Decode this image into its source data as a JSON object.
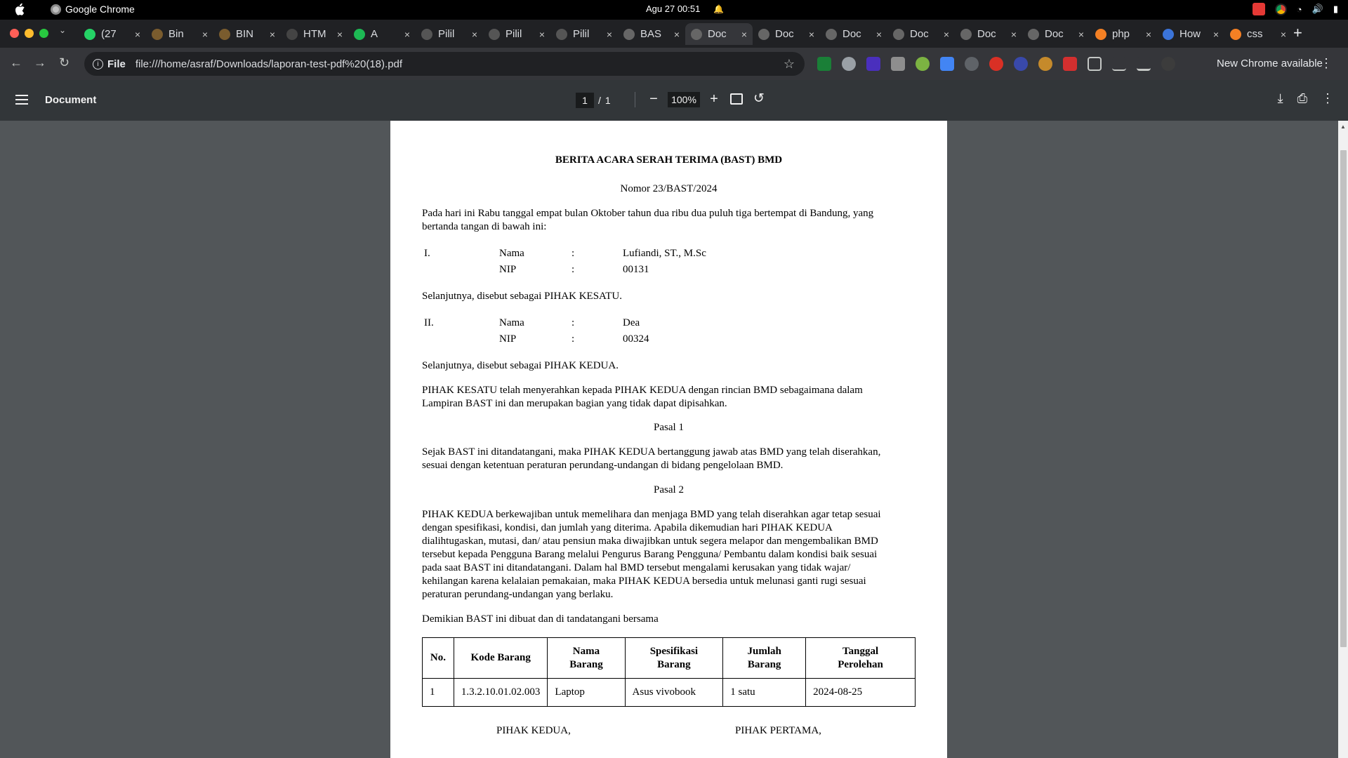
{
  "menubar": {
    "app_name": "Google Chrome",
    "clock": "Agu 27  00:51"
  },
  "tabs": [
    {
      "title": "(27",
      "favicon": "whatsapp-icon",
      "color": "#25d366"
    },
    {
      "title": "Bin",
      "favicon": "binance-icon",
      "color": "#7a5c2e"
    },
    {
      "title": "BIN",
      "favicon": "binance-icon",
      "color": "#7a5c2e"
    },
    {
      "title": "HTM",
      "favicon": "openai-icon",
      "color": "#444"
    },
    {
      "title": "A",
      "favicon": "spotify-icon",
      "color": "#1db954"
    },
    {
      "title": "Pilil",
      "favicon": "link-icon",
      "color": "#555"
    },
    {
      "title": "Pilil",
      "favicon": "link-icon",
      "color": "#555"
    },
    {
      "title": "Pilil",
      "favicon": "link-icon",
      "color": "#555"
    },
    {
      "title": "BAS",
      "favicon": "globe-icon",
      "color": "#666"
    },
    {
      "title": "Doc",
      "favicon": "globe-icon",
      "color": "#666",
      "active": true
    },
    {
      "title": "Doc",
      "favicon": "globe-icon",
      "color": "#666"
    },
    {
      "title": "Doc",
      "favicon": "globe-icon",
      "color": "#666"
    },
    {
      "title": "Doc",
      "favicon": "globe-icon",
      "color": "#666"
    },
    {
      "title": "Doc",
      "favicon": "globe-icon",
      "color": "#666"
    },
    {
      "title": "Doc",
      "favicon": "globe-icon",
      "color": "#666"
    },
    {
      "title": "php",
      "favicon": "stackoverflow-icon",
      "color": "#f48024"
    },
    {
      "title": "How",
      "favicon": "ycombinator-icon",
      "color": "#3b74d9"
    },
    {
      "title": "css",
      "favicon": "stackoverflow-icon",
      "color": "#f48024"
    }
  ],
  "toolbar": {
    "scheme": "File",
    "url": "file:///home/asraf/Downloads/laporan-test-pdf%20(18).pdf",
    "update_label": "New Chrome available"
  },
  "pdf": {
    "title": "Document",
    "page_current": "1",
    "page_sep": "/",
    "page_total": "1",
    "zoom": "100%"
  },
  "doc": {
    "heading": "BERITA ACARA SERAH TERIMA (BAST) BMD",
    "number": "Nomor 23/BAST/2024",
    "intro_1": "Pada hari ini Rabu tanggal empat bulan Oktober tahun dua ribu dua puluh tiga bertempat di Bandung, yang",
    "intro_2": "bertanda tangan di bawah ini:",
    "party1": {
      "roman": "I.",
      "name_label": "Nama",
      "name": "Lufiandi, ST., M.Sc",
      "nip_label": "NIP",
      "nip": "00131"
    },
    "party1_desc": "Selanjutnya, disebut sebagai PIHAK KESATU.",
    "party2": {
      "roman": "II.",
      "name_label": "Nama",
      "name": "Dea",
      "nip_label": "NIP",
      "nip": "00324"
    },
    "party2_desc": "Selanjutnya, disebut sebagai PIHAK KEDUA.",
    "colon": ":",
    "handover_1": "PIHAK KESATU telah menyerahkan kepada PIHAK KEDUA dengan rincian BMD sebagaimana dalam",
    "handover_2": "Lampiran BAST ini dan merupakan bagian yang tidak dapat dipisahkan.",
    "pasal1_title": "Pasal 1",
    "pasal1_1": "Sejak BAST ini ditandatangani, maka PIHAK KEDUA bertanggung jawab atas BMD yang telah diserahkan,",
    "pasal1_2": "sesuai dengan ketentuan peraturan perundang-undangan di bidang pengelolaan BMD.",
    "pasal2_title": "Pasal 2",
    "pasal2_lines": [
      "PIHAK KEDUA berkewajiban untuk memelihara dan menjaga BMD yang telah diserahkan agar tetap sesuai",
      "dengan spesifikasi, kondisi, dan jumlah yang diterima. Apabila dikemudian hari PIHAK KEDUA",
      "dialihtugaskan, mutasi, dan/ atau pensiun maka diwajibkan untuk segera melapor dan mengembalikan BMD",
      "tersebut kepada Pengguna Barang melalui Pengurus Barang Pengguna/ Pembantu dalam kondisi baik sesuai",
      "pada saat BAST ini ditandatangani. Dalam hal BMD tersebut mengalami kerusakan yang tidak wajar/",
      "kehilangan karena kelalaian pemakaian, maka PIHAK KEDUA bersedia untuk melunasi ganti rugi sesuai",
      "peraturan perundang-undangan yang berlaku."
    ],
    "closing": "Demikian BAST ini dibuat dan di tandatangani bersama",
    "table": {
      "headers": [
        [
          "No."
        ],
        [
          "Kode Barang"
        ],
        [
          "Nama",
          "Barang"
        ],
        [
          "Spesifikasi",
          "Barang"
        ],
        [
          "Jumlah",
          "Barang"
        ],
        [
          "Tanggal",
          "Perolehan"
        ]
      ],
      "rows": [
        [
          "1",
          "1.3.2.10.01.02.003",
          "Laptop",
          "Asus vivobook",
          "1 satu",
          "2024-08-25"
        ]
      ]
    },
    "sign_left": "PIHAK KEDUA,",
    "sign_right": "PIHAK PERTAMA,"
  }
}
